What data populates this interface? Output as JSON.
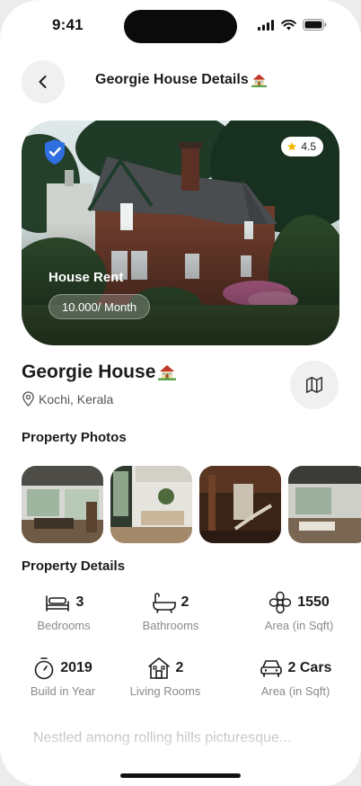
{
  "status_bar": {
    "time": "9:41"
  },
  "header": {
    "title": "Georgie House Details",
    "emoji": "🏠"
  },
  "hero": {
    "rating": "4.5",
    "rent_label": "House Rent",
    "price": "10.000/ Month"
  },
  "listing": {
    "name": "Georgie House",
    "emoji": "🏠",
    "location": "Kochi, Kerala"
  },
  "photos_section": {
    "title": "Property Photos",
    "count": 4
  },
  "details_section": {
    "title": "Property Details",
    "items": [
      {
        "icon": "bed-icon",
        "value": "3",
        "label": "Bedrooms"
      },
      {
        "icon": "bathtub-icon",
        "value": "2",
        "label": "Bathrooms"
      },
      {
        "icon": "flower-icon",
        "value": "1550",
        "label": "Area (in Sqft)"
      },
      {
        "icon": "timer-icon",
        "value": "2019",
        "label": "Build in Year"
      },
      {
        "icon": "house-icon",
        "value": "2",
        "label": "Living Rooms"
      },
      {
        "icon": "car-icon",
        "value": "2 Cars",
        "label": "Area (in Sqft)"
      }
    ]
  },
  "description": "Nestled among rolling hills picturesque...",
  "colors": {
    "verified_blue": "#2f6fe0",
    "star": "#f5b800",
    "muted_text": "#8a8a8a"
  }
}
